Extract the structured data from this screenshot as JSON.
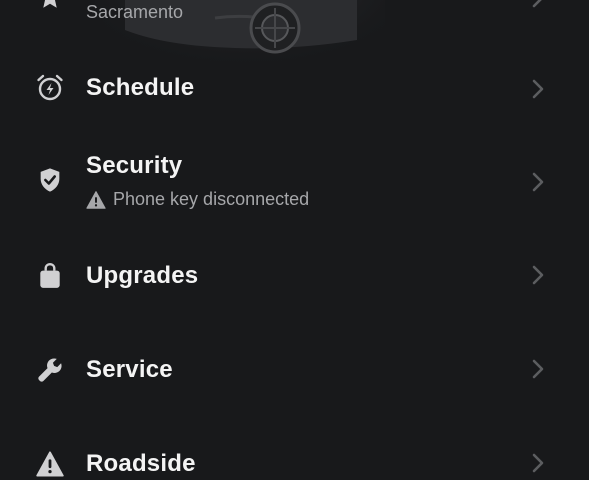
{
  "location_row": {
    "subtitle": "Sacramento",
    "icon": "star-icon"
  },
  "menu": [
    {
      "key": "schedule",
      "label": "Schedule",
      "icon": "alarm-clock-bolt-icon"
    },
    {
      "key": "security",
      "label": "Security",
      "icon": "shield-check-icon",
      "status": "Phone key disconnected",
      "status_icon": "warning-triangle-icon"
    },
    {
      "key": "upgrades",
      "label": "Upgrades",
      "icon": "shopping-bag-icon"
    },
    {
      "key": "service",
      "label": "Service",
      "icon": "wrench-icon"
    },
    {
      "key": "roadside",
      "label": "Roadside",
      "icon": "warning-triangle-icon"
    }
  ],
  "colors": {
    "background": "#18191b",
    "text": "#f4f4f4",
    "subtext": "#a6a7aa",
    "icon": "#d0d0d2",
    "chevron": "#5c5d60"
  }
}
